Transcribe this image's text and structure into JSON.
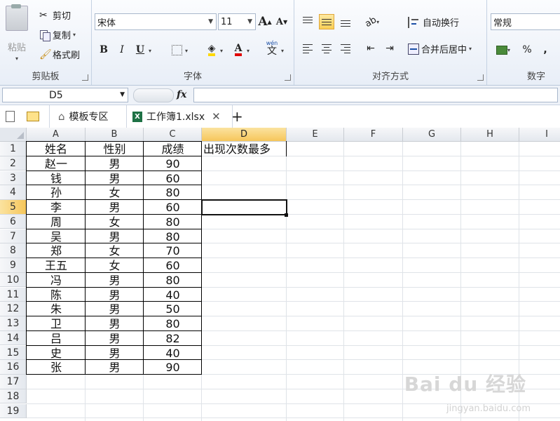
{
  "ribbon": {
    "clipboard": {
      "paste": "粘贴",
      "cut": "剪切",
      "copy": "复制",
      "format_painter": "格式刷",
      "label": "剪贴板"
    },
    "font": {
      "font_name": "宋体",
      "font_size": "11",
      "bold": "B",
      "italic": "I",
      "underline": "U",
      "grow": "A",
      "shrink": "A",
      "label": "字体",
      "wen": "wén"
    },
    "alignment": {
      "wrap": "自动换行",
      "merge": "合并后居中",
      "label": "对齐方式"
    },
    "number": {
      "format": "常规",
      "percent": "%",
      "label": "数字"
    }
  },
  "formula_bar": {
    "name_box": "D5",
    "fx": "fx"
  },
  "tabs": {
    "templates": "模板专区",
    "workbook": "工作簿1.xlsx",
    "add": "+"
  },
  "columns": [
    "A",
    "B",
    "C",
    "D",
    "E",
    "F",
    "G",
    "H",
    "I"
  ],
  "active_cell": "D5",
  "rows": [
    "1",
    "2",
    "3",
    "4",
    "5",
    "6",
    "7",
    "8",
    "9",
    "10",
    "11",
    "12",
    "13",
    "14",
    "15",
    "16",
    "17",
    "18",
    "19"
  ],
  "table": {
    "headers": [
      "姓名",
      "性别",
      "成绩",
      "出现次数最多"
    ],
    "rows": [
      [
        "赵一",
        "男",
        "90"
      ],
      [
        "钱",
        "男",
        "60"
      ],
      [
        "孙",
        "女",
        "80"
      ],
      [
        "李",
        "男",
        "60"
      ],
      [
        "周",
        "女",
        "80"
      ],
      [
        "吴",
        "男",
        "80"
      ],
      [
        "郑",
        "女",
        "70"
      ],
      [
        "王五",
        "女",
        "60"
      ],
      [
        "冯",
        "男",
        "80"
      ],
      [
        "陈",
        "男",
        "40"
      ],
      [
        "朱",
        "男",
        "50"
      ],
      [
        "卫",
        "男",
        "80"
      ],
      [
        "吕",
        "男",
        "82"
      ],
      [
        "史",
        "男",
        "40"
      ],
      [
        "张",
        "男",
        "90"
      ]
    ]
  },
  "watermark": {
    "brand": "Bai du 经验",
    "url": "jingyan.baidu.com"
  }
}
